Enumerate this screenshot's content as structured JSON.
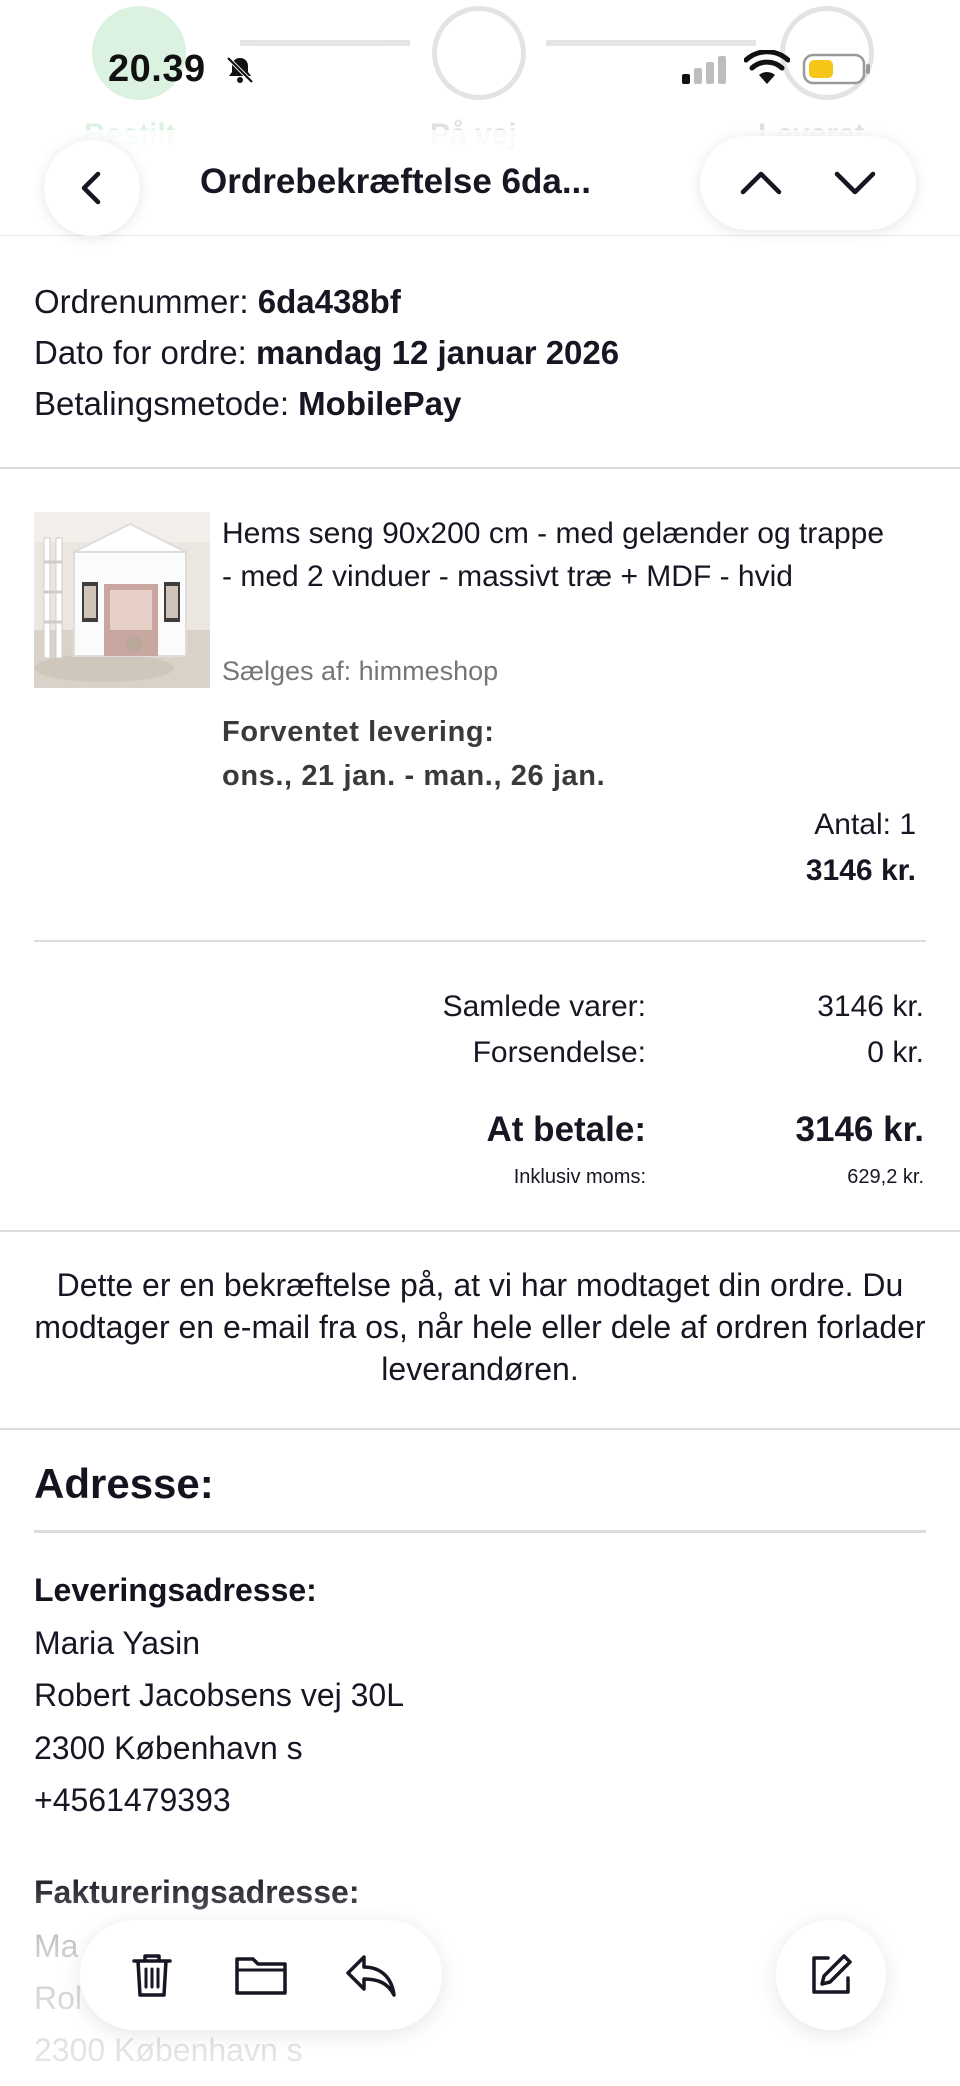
{
  "status_bar": {
    "time": "20.39",
    "icons": [
      "bell-slash-icon",
      "signal-icon",
      "wifi-icon",
      "battery-low-icon"
    ],
    "battery_color": "#f5c518"
  },
  "tracker_ghost": {
    "steps": [
      "Bestilt",
      "På vej",
      "Leveret"
    ]
  },
  "header": {
    "title": "Ordrebekræftelse  6da...",
    "back_icon": "chevron-left-icon",
    "prev_icon": "chevron-up-icon",
    "next_icon": "chevron-down-icon"
  },
  "order": {
    "number_label": "Ordrenummer:",
    "number_value": "6da438bf",
    "date_label": "Dato for ordre:",
    "date_value": "mandag 12 januar 2026",
    "payment_label": "Betalingsmetode:",
    "payment_value": "MobilePay"
  },
  "product": {
    "title": "Hems seng 90x200 cm - med gelænder og trappe - med 2 vinduer - massivt træ + MDF - hvid",
    "seller": "Sælges af: himmeshop",
    "delivery_label": "Forventet levering:",
    "delivery_dates": "ons., 21 jan. - man., 26 jan.",
    "quantity": "Antal: 1",
    "price": "3146 kr."
  },
  "totals": {
    "items_label": "Samlede varer:",
    "items_value": "3146 kr.",
    "shipping_label": "Forsendelse:",
    "shipping_value": "0 kr.",
    "pay_label": "At betale:",
    "pay_value": "3146 kr.",
    "vat_label": "Inklusiv moms:",
    "vat_value": "629,2 kr."
  },
  "confirmation": {
    "text": "Dette er en bekræftelse på, at vi har modtaget din ordre. Du modtager en e-mail fra os, når hele eller dele af ordren forlader leverandøren."
  },
  "address": {
    "heading": "Adresse:",
    "delivery": {
      "label": "Leveringsadresse:",
      "name": "Maria Yasin",
      "street": "Robert Jacobsens vej 30L",
      "city": "2300 København s",
      "phone": "+4561479393"
    },
    "billing": {
      "label": "Faktureringsadresse:",
      "name": "Ma",
      "street": "Rol",
      "city": "2300 København s"
    }
  },
  "toolbar": {
    "icons": [
      "trash-icon",
      "folder-icon",
      "reply-icon",
      "compose-icon"
    ]
  }
}
